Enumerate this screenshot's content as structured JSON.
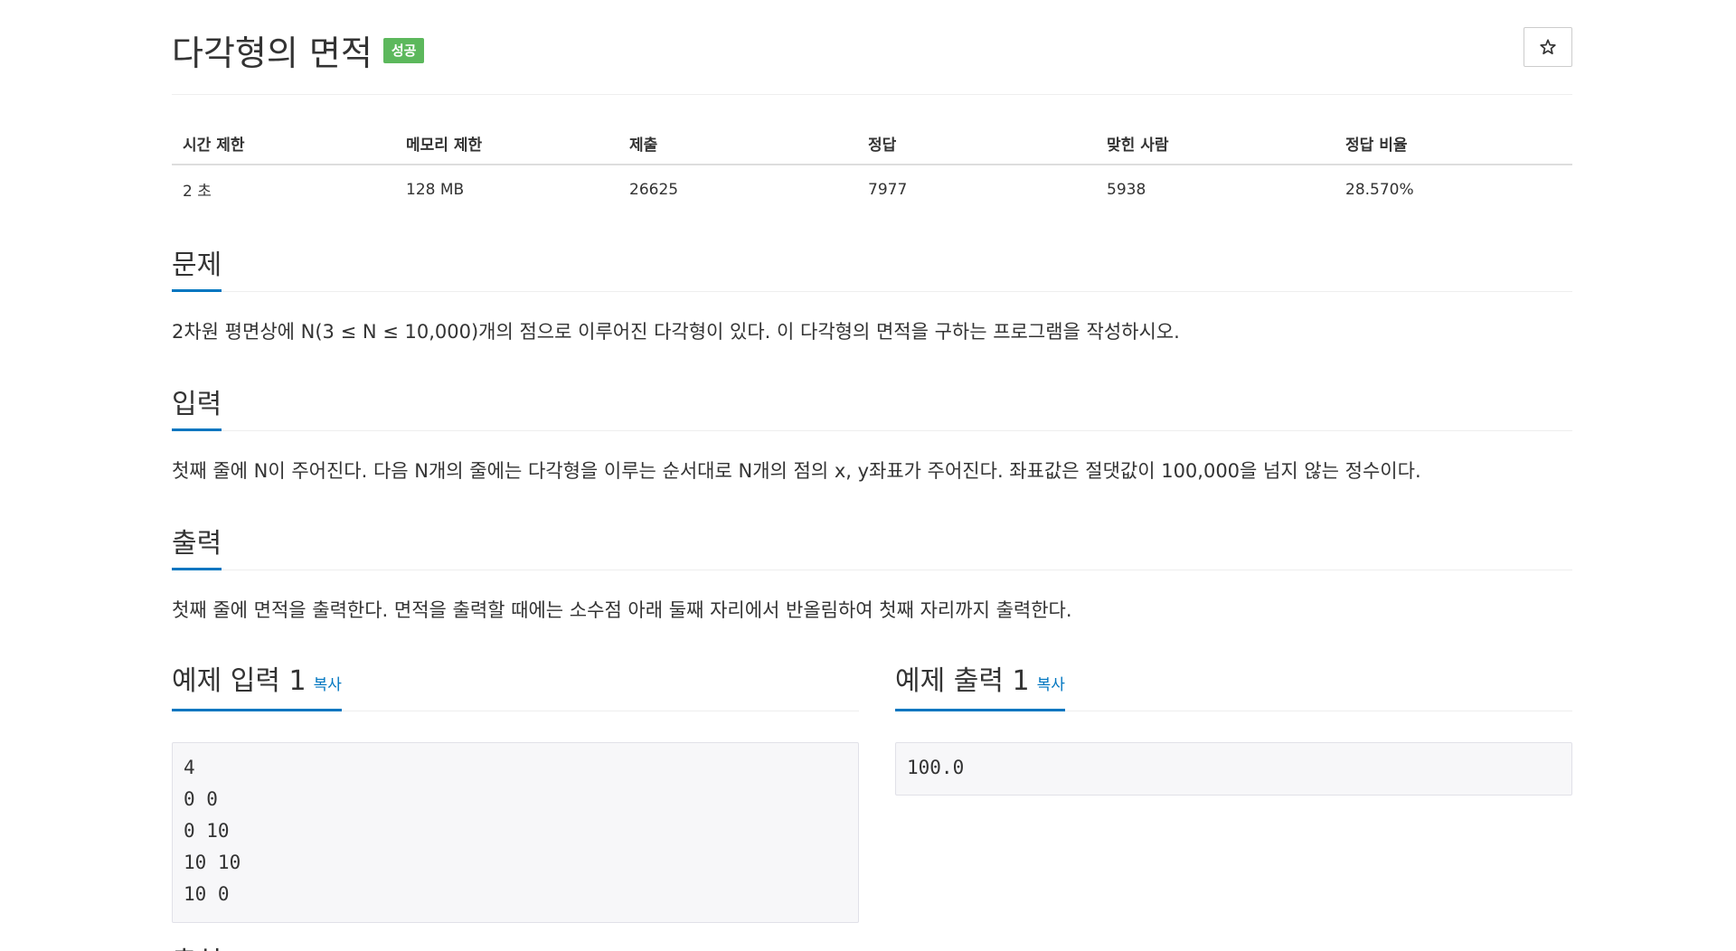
{
  "problem": {
    "title": "다각형의 면적",
    "badge": "성공",
    "star_icon": "star-outline-icon"
  },
  "info_table": {
    "headers": [
      "시간 제한",
      "메모리 제한",
      "제출",
      "정답",
      "맞힌 사람",
      "정답 비율"
    ],
    "values": [
      "2 초",
      "128 MB",
      "26625",
      "7977",
      "5938",
      "28.570%"
    ]
  },
  "sections": {
    "problem": {
      "heading": "문제",
      "body": "2차원 평면상에 N(3 ≤ N ≤ 10,000)개의 점으로 이루어진 다각형이 있다. 이 다각형의 면적을 구하는 프로그램을 작성하시오."
    },
    "input": {
      "heading": "입력",
      "body": "첫째 줄에 N이 주어진다. 다음 N개의 줄에는 다각형을 이루는 순서대로 N개의 점의 x, y좌표가 주어진다. 좌표값은 절댓값이 100,000을 넘지 않는 정수이다."
    },
    "output": {
      "heading": "출력",
      "body": "첫째 줄에 면적을 출력한다. 면적을 출력할 때에는 소수점 아래 둘째 자리에서 반올림하여 첫째 자리까지 출력한다."
    }
  },
  "samples": {
    "input": {
      "heading": "예제 입력 1",
      "copy_label": "복사",
      "lines": [
        "4",
        "0 0",
        "0 10",
        "10 10",
        "10 0"
      ]
    },
    "output": {
      "heading": "예제 출력 1",
      "copy_label": "복사",
      "lines": [
        "100.0"
      ]
    }
  },
  "next_section_partial": {
    "heading": "출처"
  },
  "colors": {
    "accent": "#0076c0",
    "success_badge": "#5cb85c"
  }
}
